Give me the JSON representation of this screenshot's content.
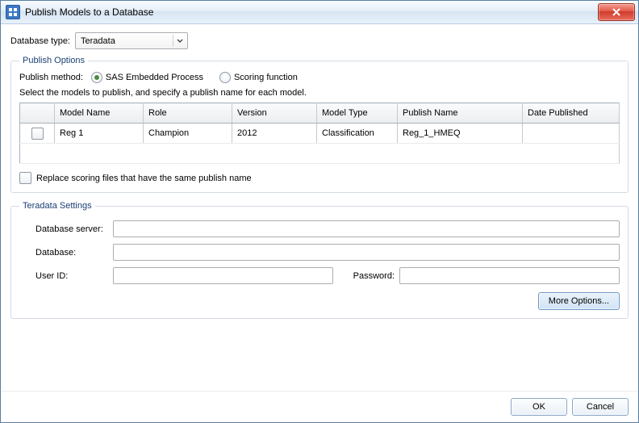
{
  "window": {
    "title": "Publish Models to a Database"
  },
  "dbType": {
    "label": "Database type:",
    "value": "Teradata"
  },
  "publishOptions": {
    "legend": "Publish Options",
    "methodLabel": "Publish method:",
    "methods": {
      "sas": "SAS Embedded Process",
      "scoring": "Scoring function"
    },
    "hint": "Select the models to publish, and specify a publish name for each model.",
    "columns": {
      "modelName": "Model Name",
      "role": "Role",
      "version": "Version",
      "modelType": "Model Type",
      "publishName": "Publish Name",
      "datePublished": "Date Published"
    },
    "rows": [
      {
        "modelName": "Reg 1",
        "role": "Champion",
        "version": "2012",
        "modelType": "Classification",
        "publishName": "Reg_1_HMEQ",
        "datePublished": ""
      }
    ],
    "replaceLabel": "Replace scoring files that have the same publish name"
  },
  "settings": {
    "legend": "Teradata Settings",
    "serverLabel": "Database server:",
    "databaseLabel": "Database:",
    "userLabel": "User ID:",
    "passwordLabel": "Password:",
    "serverValue": "",
    "databaseValue": "",
    "userValue": "",
    "passwordValue": "",
    "moreLabel": "More Options..."
  },
  "footer": {
    "ok": "OK",
    "cancel": "Cancel"
  }
}
